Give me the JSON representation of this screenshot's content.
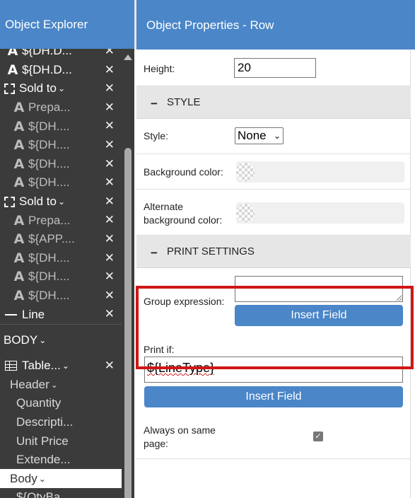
{
  "left_panel": {
    "title": "Object Explorer",
    "tree_top": [
      {
        "icon": "A",
        "label": "${DH.D...",
        "indent": "lvl1",
        "dim": false
      },
      {
        "icon": "A",
        "label": "${DH.D...",
        "indent": "lvl1",
        "dim": false
      },
      {
        "icon": "box",
        "label": "Sold to",
        "indent": "lvl1",
        "dim": false,
        "chevron": true
      },
      {
        "icon": "A",
        "label": "Prepa...",
        "indent": "lvl2",
        "dim": true
      },
      {
        "icon": "A",
        "label": "${DH....",
        "indent": "lvl2",
        "dim": true
      },
      {
        "icon": "A",
        "label": "${DH....",
        "indent": "lvl2",
        "dim": true
      },
      {
        "icon": "A",
        "label": "${DH....",
        "indent": "lvl2",
        "dim": true
      },
      {
        "icon": "A",
        "label": "${DH....",
        "indent": "lvl2",
        "dim": true
      },
      {
        "icon": "box",
        "label": "Sold to",
        "indent": "lvl1",
        "dim": false,
        "chevron": true
      },
      {
        "icon": "A",
        "label": "Prepa...",
        "indent": "lvl2",
        "dim": true
      },
      {
        "icon": "A",
        "label": "${APP....",
        "indent": "lvl2",
        "dim": true
      },
      {
        "icon": "A",
        "label": "${DH....",
        "indent": "lvl2",
        "dim": true
      },
      {
        "icon": "A",
        "label": "${DH....",
        "indent": "lvl2",
        "dim": true
      },
      {
        "icon": "A",
        "label": "${DH....",
        "indent": "lvl2",
        "dim": true
      },
      {
        "icon": "line",
        "label": "Line",
        "indent": "lvl1",
        "dim": false
      }
    ],
    "body_label": "BODY",
    "table_label": "Table...",
    "header_label": "Header",
    "header_children": [
      "Quantity",
      "Descripti...",
      "Unit Price",
      "Extende..."
    ],
    "body_child_label": "Body",
    "last_partial": "${QtyBa",
    "close_glyph": "✕",
    "chevron_glyph": "⌄"
  },
  "right_panel": {
    "title": "Object Properties - Row",
    "height_label": "Height:",
    "height_value": "20",
    "style_section": "STYLE",
    "style_label": "Style:",
    "style_value": "None",
    "bg_label": "Background color:",
    "alt_bg_label_1": "Alternate",
    "alt_bg_label_2": "background color:",
    "print_section": "PRINT SETTINGS",
    "group_label": "Group expression:",
    "group_value": "",
    "insert_field_1": "Insert Field",
    "print_if_label": "Print if:",
    "print_if_value": "${LineType}",
    "insert_field_2": "Insert Field",
    "same_page_label_1": "Always on same",
    "same_page_label_2": "page:",
    "same_page_checked": true,
    "section_dash": "−"
  },
  "colors": {
    "header_blue": "#4a86c8",
    "tree_bg": "#3b3b3b",
    "highlight_red": "#d01616"
  }
}
